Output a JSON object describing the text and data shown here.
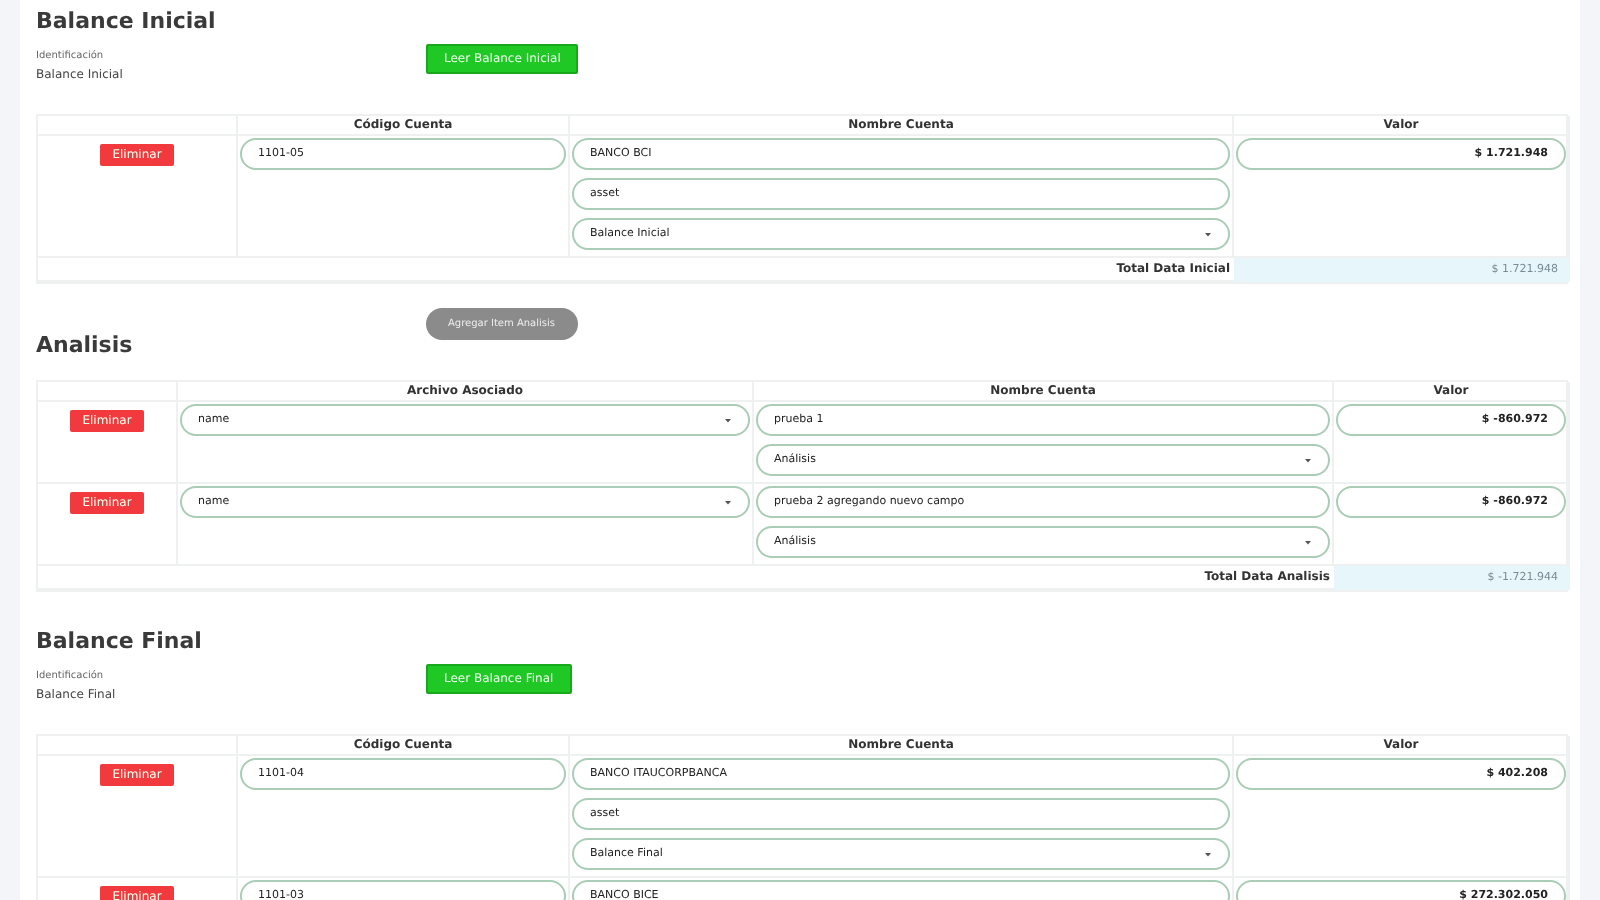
{
  "sections": [
    {
      "kind": "balance",
      "title": "Balance Inicial",
      "id_label": "Identificación",
      "id_value": "Balance Inicial",
      "action_button": "Leer Balance Inicial",
      "columns": [
        "Código Cuenta",
        "Nombre Cuenta",
        "Valor"
      ],
      "rows": [
        {
          "delete_button": "Eliminar",
          "codigo": "1101-05",
          "nombre": "BANCO BCI",
          "tipo": "asset",
          "categoria": "Balance Inicial",
          "valor": "$ 1.721.948"
        }
      ],
      "total": {
        "label": "Total Data Inicial",
        "value": "$ 1.721.948"
      }
    },
    {
      "kind": "analisis",
      "title": "Analisis",
      "add_button": "Agregar Item Analisis",
      "columns": [
        "Archivo Asociado",
        "Nombre Cuenta",
        "Valor"
      ],
      "rows": [
        {
          "delete_button": "Eliminar",
          "archivo": "name",
          "nombre": "prueba 1",
          "categoria": "Análisis",
          "valor": "$ -860.972"
        },
        {
          "delete_button": "Eliminar",
          "archivo": "name",
          "nombre": "prueba 2 agregando nuevo campo",
          "categoria": "Análisis",
          "valor": "$ -860.972"
        }
      ],
      "total": {
        "label": "Total Data Analisis",
        "value": "$ -1.721.944"
      }
    },
    {
      "kind": "balance",
      "title": "Balance Final",
      "id_label": "Identificación",
      "id_value": "Balance Final",
      "action_button": "Leer Balance Final",
      "columns": [
        "Código Cuenta",
        "Nombre Cuenta",
        "Valor"
      ],
      "rows": [
        {
          "delete_button": "Eliminar",
          "codigo": "1101-04",
          "nombre": "BANCO ITAUCORPBANCA",
          "tipo": "asset",
          "categoria": "Balance Final",
          "valor": "$ 402.208"
        },
        {
          "delete_button": "Eliminar",
          "codigo": "1101-03",
          "nombre": "BANCO BICE",
          "valor": "$ 272.302.050"
        }
      ]
    }
  ]
}
